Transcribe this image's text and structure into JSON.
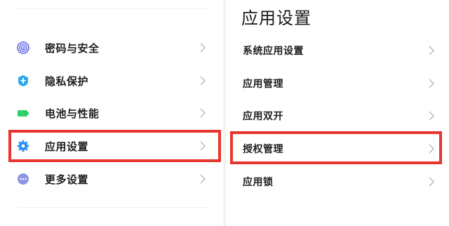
{
  "left_menu": {
    "items": [
      {
        "label": "密码与安全",
        "icon": "fingerprint-icon",
        "icon_color": "#5a64e8"
      },
      {
        "label": "隐私保护",
        "icon": "privacy-shield-icon",
        "icon_color": "#2aa7f0"
      },
      {
        "label": "电池与性能",
        "icon": "battery-icon",
        "icon_color": "#2fcf6a"
      },
      {
        "label": "应用设置",
        "icon": "gear-icon",
        "icon_color": "#2b8df5",
        "highlighted": true
      },
      {
        "label": "更多设置",
        "icon": "more-icon",
        "icon_color": "#8b95e6"
      }
    ]
  },
  "right_panel": {
    "title": "应用设置",
    "items": [
      {
        "label": "系统应用设置"
      },
      {
        "label": "应用管理"
      },
      {
        "label": "应用双开"
      },
      {
        "label": "授权管理",
        "highlighted": true
      },
      {
        "label": "应用锁"
      }
    ]
  },
  "colors": {
    "highlight_border": "#e8352d",
    "chevron": "#b8b8b8"
  }
}
